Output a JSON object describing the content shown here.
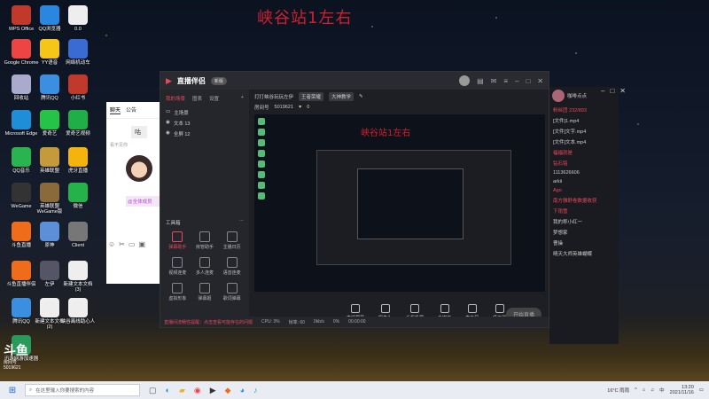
{
  "desktop": {
    "banner": "峡谷站1左右",
    "icons": [
      {
        "label": "WPS Office",
        "color": "#c0392b"
      },
      {
        "label": "QQ浏览器",
        "color": "#2a86e0"
      },
      {
        "label": "0.0",
        "color": "#eee"
      },
      {
        "label": "Google Chrome",
        "color": "#e44"
      },
      {
        "label": "YY语音",
        "color": "#f5c518"
      },
      {
        "label": "网络机动车",
        "color": "#3a6ad4"
      },
      {
        "label": "回收站",
        "color": "#aac"
      },
      {
        "label": "腾讯QQ",
        "color": "#3a8fe0"
      },
      {
        "label": "小红书",
        "color": "#c0392b"
      },
      {
        "label": "Microsoft Edge",
        "color": "#1e8ed8"
      },
      {
        "label": "爱奇艺",
        "color": "#25c448"
      },
      {
        "label": "爱奇艺视频",
        "color": "#1fae48"
      },
      {
        "label": "QQ音乐",
        "color": "#2ab44f"
      },
      {
        "label": "英雄联盟",
        "color": "#c49a3a"
      },
      {
        "label": "虎牙直播",
        "color": "#f4b40c"
      },
      {
        "label": "WeGame",
        "color": "#333"
      },
      {
        "label": "英雄联盟 WeGame版",
        "color": "#8a6a3a"
      },
      {
        "label": "微信",
        "color": "#26b24a"
      },
      {
        "label": "斗鱼直播",
        "color": "#ef6c1a"
      },
      {
        "label": "原神",
        "color": "#5b8fd8"
      },
      {
        "label": "Client",
        "color": "#777"
      },
      {
        "label": "斗鱼直播伴侣",
        "color": "#ef6c1a"
      },
      {
        "label": "左伊",
        "color": "#556"
      },
      {
        "label": "新建文本文档 (3)",
        "color": "#eee"
      },
      {
        "label": "腾讯QQ",
        "color": "#3a8fe0"
      },
      {
        "label": "新建文本文档 (2)",
        "color": "#eee"
      },
      {
        "label": "峡谷离线助心人",
        "color": "#eee"
      },
      {
        "label": "迅游网游加速器",
        "color": "#2a9a5a"
      }
    ]
  },
  "chat": {
    "tabs": [
      "聊天",
      "公告"
    ],
    "message": "咕",
    "system_note": "看不见你",
    "mention": "@全体成员"
  },
  "app": {
    "title": "直播伴侣",
    "version": "新版",
    "sidebar": {
      "tabs": [
        "我的场景",
        "图表",
        "设置"
      ],
      "scene_group": "主场景",
      "scenes": [
        "文本 13",
        "全屏 12"
      ],
      "tools_title": "工具箱",
      "tools": [
        {
          "label": "弹幕助手",
          "active": true
        },
        {
          "label": "房管助手",
          "active": false
        },
        {
          "label": "主播日历",
          "active": false
        },
        {
          "label": "视频连麦",
          "active": false
        },
        {
          "label": "多人连麦",
          "active": false
        },
        {
          "label": "语音连麦",
          "active": false
        },
        {
          "label": "虚拟形象",
          "active": false
        },
        {
          "label": "弹幕姬",
          "active": false
        },
        {
          "label": "歌词弹幕",
          "active": false
        }
      ]
    },
    "stream": {
      "title": "打打峡谷玩玩左伊",
      "category": "王者荣耀",
      "tag": "大神教学",
      "room_label": "房间号",
      "room_id": "5019621",
      "fans": "0"
    },
    "preview_banner": "峡谷站1左右",
    "bottom_tools": [
      "直播屏幕",
      "摄像头",
      "手机投屏",
      "多媒体",
      "麦克风",
      "扬声器"
    ],
    "start_button": "开始直播",
    "status": {
      "warning": "直播间流畅性提醒：点击查看可能存在的问题",
      "cpu": "CPU: 3%",
      "fps": "帧率: 60",
      "bitrate": "0kb/s",
      "drop": "0%",
      "time": "00:00:00"
    }
  },
  "right_panel": {
    "name": "咖啡点点",
    "section_fans": "粉丝团 232/893",
    "items": [
      {
        "text": "[文件]1.mp4",
        "style": "normal"
      },
      {
        "text": "[文件]文字.mp4",
        "style": "normal"
      },
      {
        "text": "[文件]文本.mp4",
        "style": "normal"
      },
      {
        "text": "福福就是",
        "style": "red"
      },
      {
        "text": "钻石铭",
        "style": "red"
      },
      {
        "text": "1113626606",
        "style": "normal"
      },
      {
        "text": "arkii",
        "style": "normal"
      },
      {
        "text": "Ago",
        "style": "red"
      },
      {
        "text": "南方雅舒卷数据收获",
        "style": "red"
      },
      {
        "text": "下雨雪",
        "style": "red"
      },
      {
        "text": "我的称小红一",
        "style": "normal"
      },
      {
        "text": "梦想家",
        "style": "normal"
      },
      {
        "text": "曹操",
        "style": "normal"
      },
      {
        "text": "晴天大师英雄蝴蝶",
        "style": "normal"
      }
    ]
  },
  "watermark": {
    "brand": "斗鱼",
    "sub": "房间号",
    "room": "5019621"
  },
  "taskbar": {
    "search_placeholder": "在这里输入你要搜索的内容",
    "weather": "16°C 雨雨",
    "time": "13:20",
    "date": "2021/11/16",
    "lang": "中"
  }
}
